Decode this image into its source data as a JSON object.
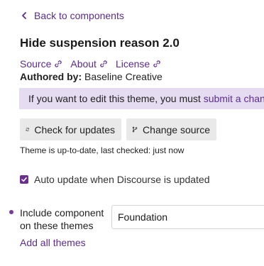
{
  "back_link": {
    "label": "Back to components",
    "icon": "chevron-left-icon"
  },
  "component": {
    "title": "Hide suspension reason 2.0",
    "links": [
      {
        "label": "Source",
        "icon": "link-icon"
      },
      {
        "label": "About",
        "icon": "link-icon"
      },
      {
        "label": "License",
        "icon": "link-icon"
      }
    ],
    "authored_by_label": "Authored by:",
    "author": "Baseline Creative"
  },
  "notice": {
    "text": "If you want to edit this theme, you must",
    "link": "submit a change"
  },
  "buttons": {
    "check_updates": {
      "label": "Check for updates",
      "icon": "refresh-icon"
    },
    "change_source": {
      "label": "Change source",
      "icon": "code-branch-icon"
    }
  },
  "update_status": "Theme is up-to-date, last checked: just now",
  "auto_update": {
    "label": "Auto update when Discourse is updated",
    "checked": true
  },
  "include_component": {
    "label": "Include component on these themes",
    "selected_theme": "Foundation"
  },
  "add_all_label": "Add all themes",
  "colors": {
    "accent": "#5b2c91",
    "notice_bg": "#e6dcf1",
    "button_bg": "#e9e9e9",
    "checkbox": "#6a2f8f"
  }
}
